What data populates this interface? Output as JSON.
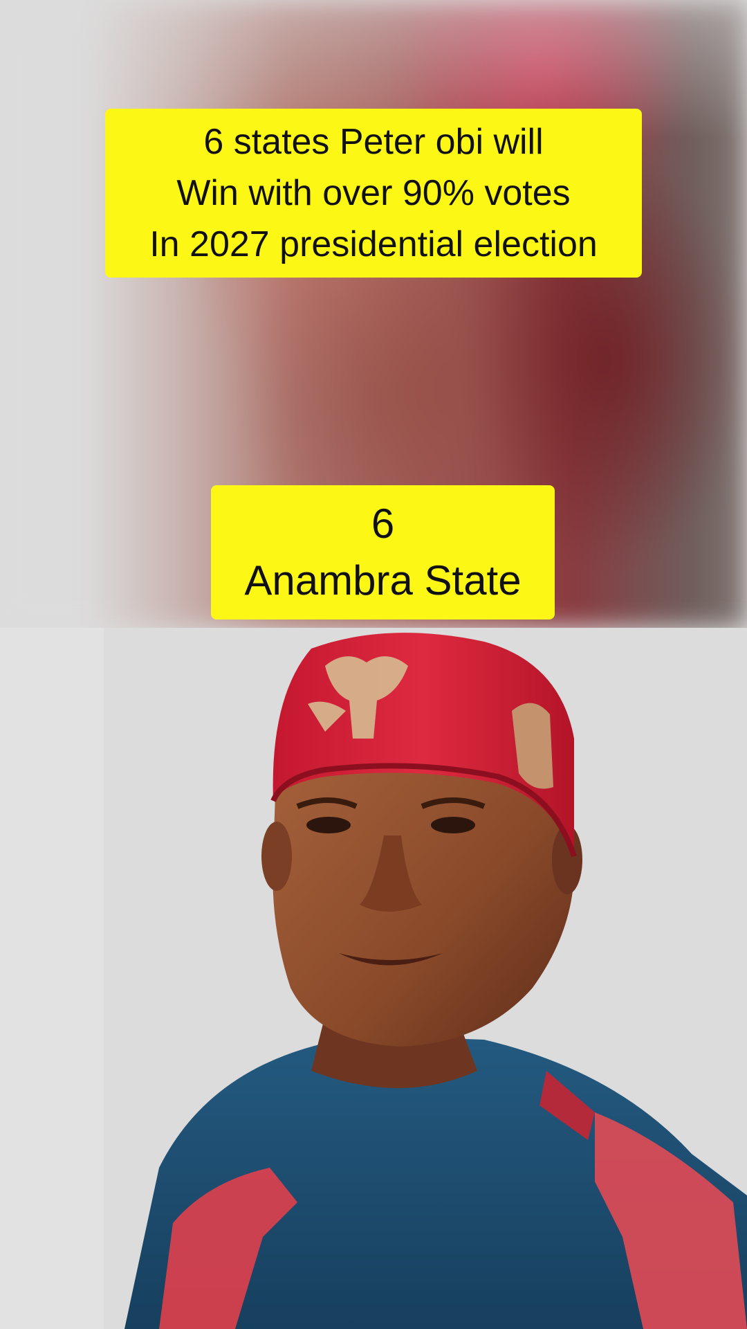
{
  "headline": {
    "lines": [
      "6 states Peter obi will",
      "Win with over 90% votes",
      "In 2027 presidential election"
    ]
  },
  "rank_card": {
    "number": "6",
    "state": "Anambra State"
  },
  "colors": {
    "label_background": "#fdf716",
    "text": "#111111",
    "cap_red": "#d21d35",
    "robe_blue": "#1d4f76",
    "background_gray": "#dcdcdc"
  }
}
